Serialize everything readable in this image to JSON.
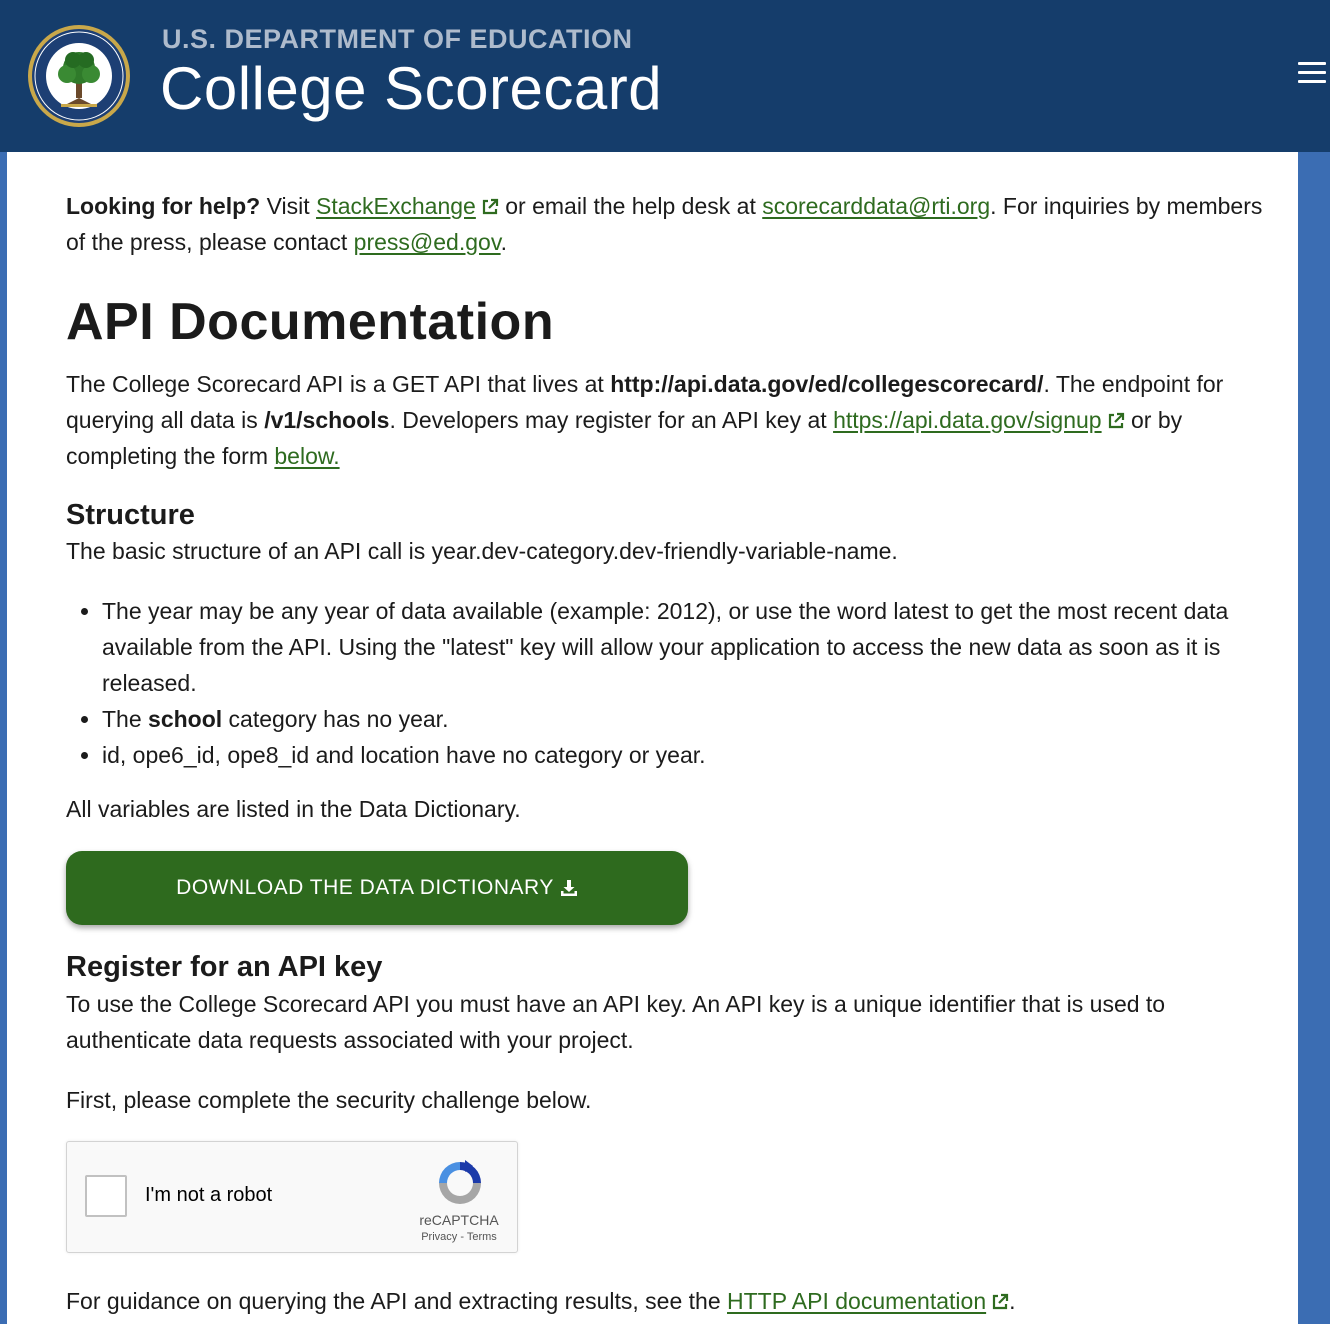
{
  "header": {
    "agency": "U.S. DEPARTMENT OF EDUCATION",
    "title": "College Scorecard",
    "seal_icon": "department-of-education-seal",
    "menu_icon": "hamburger-menu-icon"
  },
  "help": {
    "lead": "Looking for help?",
    "visit": " Visit ",
    "stackexchange": "StackExchange",
    "email_text": " or email the help desk at ",
    "email": "scorecarddata@rti.org",
    "press_text": ". For inquiries by members of the press, please contact ",
    "press_email": "press@ed.gov",
    "end": "."
  },
  "page_title": "API Documentation",
  "intro": {
    "t1": "The College Scorecard API is a GET API that lives at ",
    "url": "http://api.data.gov/ed/collegescorecard/",
    "t2": ". The endpoint for querying all data is ",
    "endpoint": "/v1/schools",
    "t3": ". Developers may register for an API key at ",
    "signup": "https://api.data.gov/signup",
    "t4": " or by completing the form ",
    "below": "below."
  },
  "structure": {
    "heading": "Structure",
    "text": "The basic structure of an API call is year.dev-category.dev-friendly-variable-name.",
    "bullet1": "The year may be any year of data available (example: 2012), or use the word latest to get the most recent data available from the API. Using the \"latest\" key will allow your application to access the new data as soon as it is released.",
    "bullet2_pre": "The ",
    "bullet2_bold": "school",
    "bullet2_post": " category has no year.",
    "bullet3": "id, ope6_id, ope8_id and location have no category or year.",
    "all_vars": "All variables are listed in the Data Dictionary."
  },
  "download_button": "DOWNLOAD THE DATA DICTIONARY",
  "register": {
    "heading": "Register for an API key",
    "text": "To use the College Scorecard API you must have an API key. An API key is a unique identifier that is used to authenticate data requests associated with your project.",
    "first": "First, please complete the security challenge below."
  },
  "recaptcha": {
    "label": "I'm not a robot",
    "brand": "reCAPTCHA",
    "privacy": "Privacy",
    "sep": " - ",
    "terms": "Terms"
  },
  "guidance": {
    "text": "For guidance on querying the API and extracting results, see the ",
    "link": "HTTP API documentation",
    "end": "."
  },
  "colors": {
    "header_bg": "#153d6b",
    "link": "#2e6b1f",
    "button_bg": "#2e6a1e",
    "page_side": "#3b6db3"
  }
}
